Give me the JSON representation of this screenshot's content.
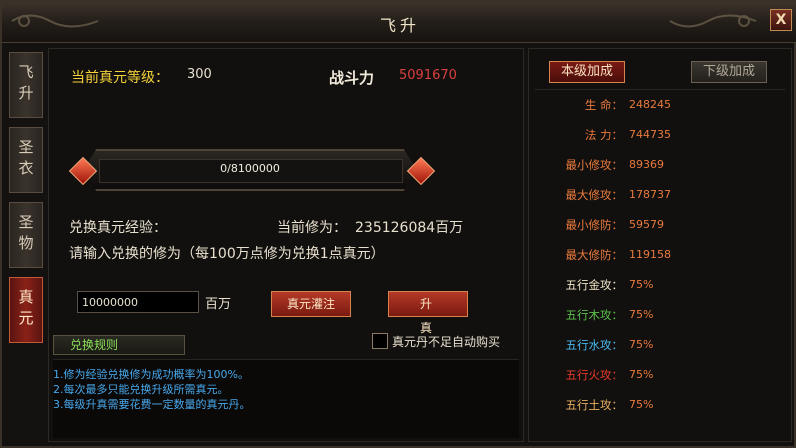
{
  "window": {
    "title": "飞升",
    "close_label": "X"
  },
  "tabs": [
    {
      "label": "飞升",
      "active": false
    },
    {
      "label": "圣衣",
      "active": false
    },
    {
      "label": "圣物",
      "active": false
    },
    {
      "label": "真元",
      "active": true
    }
  ],
  "main": {
    "level_label": "当前真元等级：",
    "level_value": "300",
    "power_label": "战斗力",
    "power_value": "5091670",
    "progress": {
      "text": "0/8100000",
      "fraction": 0.0
    },
    "exchange_label": "兑换真元经验：",
    "current_cultivation_label": "当前修为：",
    "current_cultivation_value": "235126084百万",
    "instruction": "请输入兑换的修为（每100万点修为兑换1点真元）",
    "input_value": "10000000",
    "unit": "百万",
    "inject_button": "真元灌注",
    "upgrade_button": "升 真",
    "auto_buy_label": "真元丹不足自动购买",
    "rules_button": "兑换规则",
    "rules": [
      "1.修为经验兑换修为成功概率为100%。",
      "2.每次最多只能兑换升级所需真元。",
      "3.每级升真需要花费一定数量的真元丹。"
    ]
  },
  "side": {
    "tab_current": "本级加成",
    "tab_next": "下级加成",
    "stats": [
      {
        "label": "生    命：",
        "value": "248245",
        "label_color": "#e87a3c",
        "value_color": "#e87a3c"
      },
      {
        "label": "法    力：",
        "value": "744735",
        "label_color": "#e87a3c",
        "value_color": "#e87a3c"
      },
      {
        "label": "最小修攻：",
        "value": "89369",
        "label_color": "#e87a3c",
        "value_color": "#e87a3c"
      },
      {
        "label": "最大修攻：",
        "value": "178737",
        "label_color": "#e87a3c",
        "value_color": "#e87a3c"
      },
      {
        "label": "最小修防：",
        "value": "59579",
        "label_color": "#e87a3c",
        "value_color": "#e87a3c"
      },
      {
        "label": "最大修防：",
        "value": "119158",
        "label_color": "#e87a3c",
        "value_color": "#e87a3c"
      },
      {
        "label": "五行金攻：",
        "value": "75%",
        "label_color": "#f0e6c8",
        "value_color": "#e87a3c"
      },
      {
        "label": "五行木攻：",
        "value": "75%",
        "label_color": "#5ac04a",
        "value_color": "#e87a3c"
      },
      {
        "label": "五行水攻：",
        "value": "75%",
        "label_color": "#48b8f0",
        "value_color": "#e87a3c"
      },
      {
        "label": "五行火攻：",
        "value": "75%",
        "label_color": "#e83a2a",
        "value_color": "#e87a3c"
      },
      {
        "label": "五行土攻：",
        "value": "75%",
        "label_color": "#e8b060",
        "value_color": "#e87a3c"
      }
    ]
  }
}
